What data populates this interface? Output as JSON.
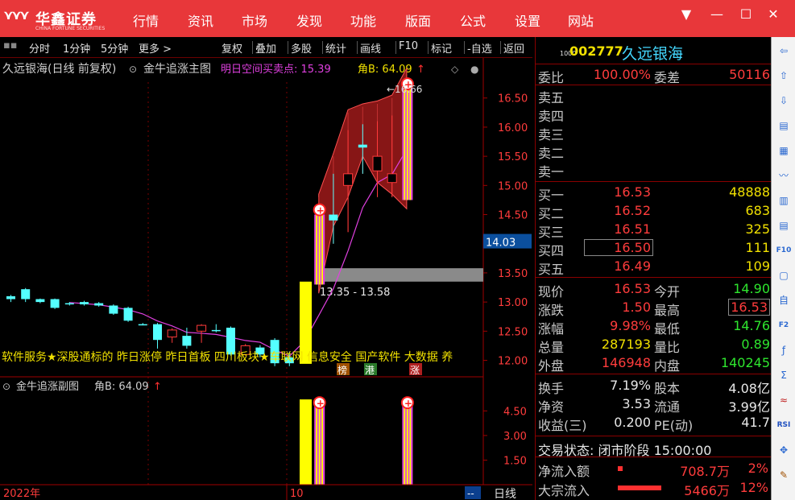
{
  "app": {
    "brand_name": "华鑫证券",
    "brand_sub": "CHINA FORTUNE SECURITIES",
    "menu": [
      "行情",
      "资讯",
      "市场",
      "发现",
      "功能",
      "版面",
      "公式",
      "设置",
      "网站"
    ],
    "window_controls": [
      "▼",
      "—",
      "☐",
      "✕"
    ]
  },
  "toolbar": {
    "left_items": [
      "分时",
      "1分钟",
      "5分钟",
      "更多 >"
    ],
    "right_items": [
      "复权",
      "叠加",
      "多股",
      "统计",
      "画线",
      "F10",
      "标记",
      "-自选",
      "返回"
    ]
  },
  "chart_header": {
    "stock_title": "久远银海(日线 前复权)",
    "indicator_name": "金牛追涨主图",
    "signal_label": "明日空间买卖点: 15.39",
    "angle_label": "角B: 64.09",
    "arrow_up": "↑",
    "peak_label": "16.66",
    "range_label": "13.35 - 13.58",
    "current_price_tag": "14.03",
    "marquee": "软件服务★深股通标的 昨日涨停 昨日首板 四川板块★车联网 信息安全 国产软件 大数据 养",
    "tags": [
      "榜",
      "港",
      "涨"
    ]
  },
  "price_axis": [
    "16.50",
    "16.00",
    "15.50",
    "15.00",
    "14.50",
    "14.03",
    "13.50",
    "13.00",
    "12.50",
    "12.00"
  ],
  "sub_header": {
    "indicator_name": "金牛追涨副图",
    "angle_label": "角B: 64.09",
    "arrow_up": "↑"
  },
  "sub_axis": [
    "4.50",
    "3.00",
    "1.50"
  ],
  "bottom_bar": {
    "year_label": "2022年",
    "month_label": "10",
    "dashes": "--",
    "period_label": "日线"
  },
  "chart_data": {
    "type": "candlestick",
    "candles": [
      {
        "o": 13.1,
        "c": 13.05,
        "h": 13.12,
        "l": 13.0
      },
      {
        "o": 13.22,
        "c": 13.05,
        "h": 13.24,
        "l": 13.0
      },
      {
        "o": 13.05,
        "c": 13.0,
        "h": 13.06,
        "l": 12.98
      },
      {
        "o": 13.05,
        "c": 12.9,
        "h": 13.06,
        "l": 12.88
      },
      {
        "o": 12.98,
        "c": 12.96,
        "h": 13.0,
        "l": 12.94
      },
      {
        "o": 13.0,
        "c": 12.96,
        "h": 13.02,
        "l": 12.94
      },
      {
        "o": 12.98,
        "c": 12.94,
        "h": 13.0,
        "l": 12.92
      },
      {
        "o": 12.94,
        "c": 12.8,
        "h": 12.96,
        "l": 12.78
      },
      {
        "o": 12.9,
        "c": 12.68,
        "h": 12.92,
        "l": 12.66
      },
      {
        "o": 12.62,
        "c": 12.6,
        "h": 12.64,
        "l": 12.6
      },
      {
        "o": 12.62,
        "c": 12.35,
        "h": 12.64,
        "l": 12.2
      },
      {
        "o": 12.4,
        "c": 12.52,
        "h": 12.55,
        "l": 12.3
      },
      {
        "o": 12.42,
        "c": 12.25,
        "h": 12.56,
        "l": 12.2
      },
      {
        "o": 12.5,
        "c": 12.6,
        "h": 12.62,
        "l": 12.3
      },
      {
        "o": 12.52,
        "c": 12.5,
        "h": 12.62,
        "l": 12.48
      },
      {
        "o": 12.56,
        "c": 12.1,
        "h": 12.58,
        "l": 12.08
      },
      {
        "o": 12.1,
        "c": 12.25,
        "h": 12.28,
        "l": 12.08
      },
      {
        "o": 12.22,
        "c": 12.1,
        "h": 12.26,
        "l": 12.05
      },
      {
        "o": 12.35,
        "c": 11.95,
        "h": 12.38,
        "l": 11.9
      },
      {
        "o": 12.05,
        "c": 11.95,
        "h": 12.15,
        "l": 11.9
      },
      {
        "o": 11.94,
        "c": 13.35,
        "h": 13.36,
        "l": 11.94,
        "special": "limit_up"
      },
      {
        "o": 13.35,
        "c": 14.5,
        "h": 14.5,
        "l": 13.3,
        "special": "signal"
      },
      {
        "o": 14.5,
        "c": 14.4,
        "h": 15.2,
        "l": 14.0
      },
      {
        "o": 15.0,
        "c": 15.2,
        "h": 15.95,
        "l": 14.2
      },
      {
        "o": 15.7,
        "c": 15.65,
        "h": 16.05,
        "l": 15.2
      },
      {
        "o": 15.25,
        "c": 15.5,
        "h": 16.1,
        "l": 14.8
      },
      {
        "o": 15.05,
        "c": 15.2,
        "h": 16.2,
        "l": 14.8
      },
      {
        "o": 14.8,
        "c": 16.53,
        "h": 16.66,
        "l": 14.75,
        "special": "signal"
      }
    ],
    "price_range": [
      11.8,
      16.8
    ],
    "sub_bars": [
      {
        "index": 20,
        "value": 5.2,
        "color": "yellow"
      },
      {
        "index": 21,
        "value": 5.2,
        "color": "stripe"
      },
      {
        "index": 27,
        "value": 5.2,
        "color": "stripe"
      }
    ],
    "sub_range": [
      0,
      5.4
    ]
  },
  "quote": {
    "code": "002777",
    "name": "久远银海",
    "weibi": {
      "label": "委比",
      "value": "100.00%",
      "label2": "委差",
      "value2": "50116"
    },
    "sell": [
      {
        "label": "卖五",
        "price": "",
        "vol": ""
      },
      {
        "label": "卖四",
        "price": "",
        "vol": ""
      },
      {
        "label": "卖三",
        "price": "",
        "vol": ""
      },
      {
        "label": "卖二",
        "price": "",
        "vol": ""
      },
      {
        "label": "卖一",
        "price": "",
        "vol": ""
      }
    ],
    "buy": [
      {
        "label": "买一",
        "price": "16.53",
        "vol": "48888"
      },
      {
        "label": "买二",
        "price": "16.52",
        "vol": "683"
      },
      {
        "label": "买三",
        "price": "16.51",
        "vol": "325"
      },
      {
        "label": "买四",
        "price": "16.50",
        "vol": "111"
      },
      {
        "label": "买五",
        "price": "16.49",
        "vol": "109"
      }
    ],
    "stats": [
      {
        "l1": "现价",
        "v1": "16.53",
        "c1": "red",
        "l2": "今开",
        "v2": "14.90",
        "c2": "green"
      },
      {
        "l1": "涨跌",
        "v1": "1.50",
        "c1": "red",
        "l2": "最高",
        "v2": "16.53",
        "c2": "red"
      },
      {
        "l1": "涨幅",
        "v1": "9.98%",
        "c1": "red",
        "l2": "最低",
        "v2": "14.76",
        "c2": "green"
      },
      {
        "l1": "总量",
        "v1": "287193",
        "c1": "yellow",
        "l2": "量比",
        "v2": "0.89",
        "c2": "green"
      },
      {
        "l1": "外盘",
        "v1": "146948",
        "c1": "red",
        "l2": "内盘",
        "v2": "140245",
        "c2": "green"
      }
    ],
    "fundamentals": [
      {
        "l1": "换手",
        "v1": "7.19%",
        "l2": "股本",
        "v2": "4.08亿"
      },
      {
        "l1": "净资",
        "v1": "3.53",
        "l2": "流通",
        "v2": "3.99亿"
      },
      {
        "l1": "收益(三)",
        "v1": "0.200",
        "l2": "PE(动)",
        "v2": "41.7"
      }
    ],
    "trade_status": "交易状态: 闭市阶段 15:00:00",
    "net_inflow": {
      "label": "净流入额",
      "value": "708.7万",
      "pct": "2%",
      "bar": 0.08
    },
    "block_inflow": {
      "label": "大宗流入",
      "value": "5466万",
      "pct": "12%",
      "bar": 0.75
    }
  },
  "sidebar_icons": [
    "arrow-left-icon",
    "arrow-up-icon",
    "arrow-down-icon",
    "book-icon",
    "grid-icon",
    "line-chart-icon",
    "candle-chart-icon",
    "list-icon",
    "f10-icon",
    "doc-icon",
    "self-select-icon",
    "f2-icon",
    "fx-icon",
    "sigma-icon",
    "waves-icon",
    "rsi-icon",
    "nav-icon",
    "pencil-icon"
  ]
}
